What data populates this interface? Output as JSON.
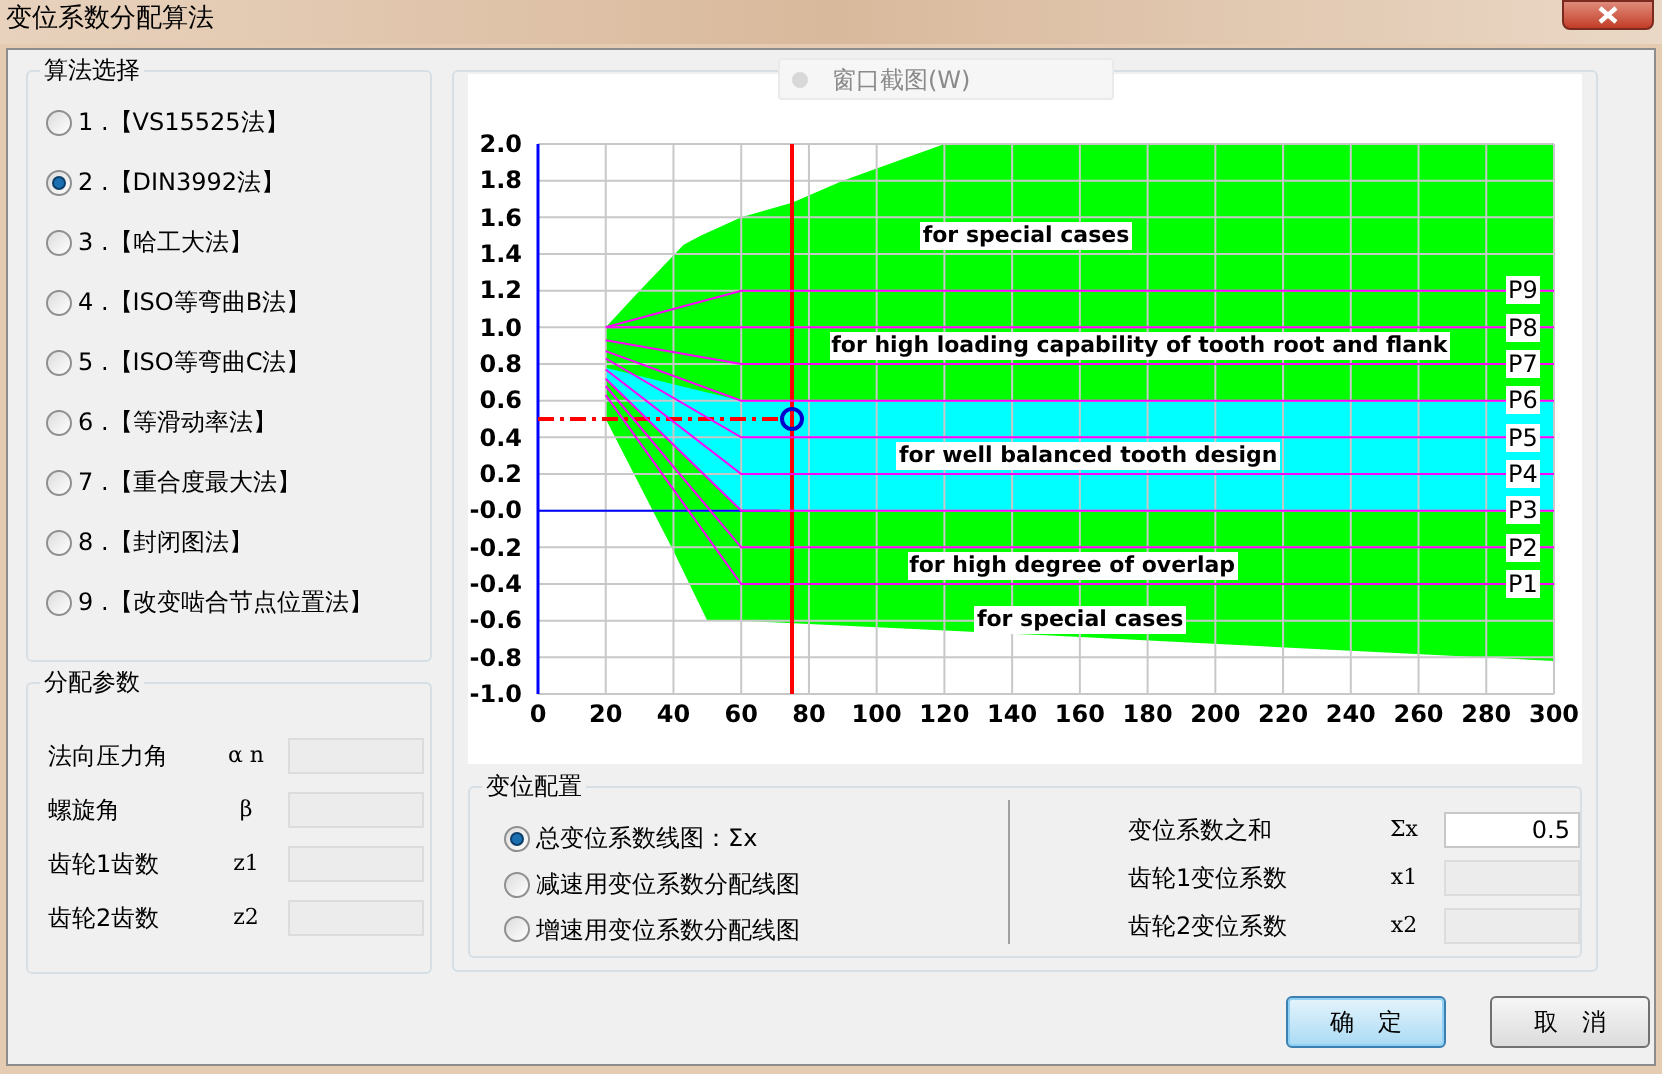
{
  "window": {
    "title": "变位系数分配算法"
  },
  "overlay": {
    "label": "窗口截图(W)"
  },
  "algorithm_group": {
    "title": "算法选择",
    "options": [
      {
        "label": "1 .【VS15525法】",
        "selected": false
      },
      {
        "label": "2 .【DIN3992法】",
        "selected": true
      },
      {
        "label": "3 .【哈工大法】",
        "selected": false
      },
      {
        "label": "4 .【ISO等弯曲B法】",
        "selected": false
      },
      {
        "label": "5 .【ISO等弯曲C法】",
        "selected": false
      },
      {
        "label": "6 .【等滑动率法】",
        "selected": false
      },
      {
        "label": "7 .【重合度最大法】",
        "selected": false
      },
      {
        "label": "8 .【封闭图法】",
        "selected": false
      },
      {
        "label": "9 .【改变啮合节点位置法】",
        "selected": false
      }
    ]
  },
  "params_group": {
    "title": "分配参数",
    "fields": [
      {
        "label": "法向压力角",
        "symbol": "α n",
        "disabled": true
      },
      {
        "label": "螺旋角",
        "symbol": "β",
        "disabled": true
      },
      {
        "label": "齿轮1齿数",
        "symbol": "z1",
        "disabled": true
      },
      {
        "label": "齿轮2齿数",
        "symbol": "z2",
        "disabled": true
      }
    ]
  },
  "chart": {
    "chart_data": {
      "type": "line",
      "xlim": [
        0,
        300
      ],
      "ylim": [
        -1,
        2
      ],
      "xticks": [
        0,
        20,
        40,
        60,
        80,
        100,
        120,
        140,
        160,
        180,
        200,
        220,
        240,
        260,
        280,
        300
      ],
      "yticks": [
        {
          "value": 2,
          "label": "2.0"
        },
        {
          "value": 1.8,
          "label": "1.8"
        },
        {
          "value": 1.6,
          "label": "1.6"
        },
        {
          "value": 1.4,
          "label": "1.4"
        },
        {
          "value": 1.2,
          "label": "1.2"
        },
        {
          "value": 1,
          "label": "1.0"
        },
        {
          "value": 0.8,
          "label": "0.8"
        },
        {
          "value": 0.6,
          "label": "0.6"
        },
        {
          "value": 0.4,
          "label": "0.4"
        },
        {
          "value": 0.2,
          "label": "0.2"
        },
        {
          "value": 0,
          "label": "-0.0"
        },
        {
          "value": -0.2,
          "label": "-0.2"
        },
        {
          "value": -0.4,
          "label": "-0.4"
        },
        {
          "value": -0.6,
          "label": "-0.6"
        },
        {
          "value": -0.8,
          "label": "-0.8"
        },
        {
          "value": -1,
          "label": "-1.0"
        }
      ],
      "grid": true,
      "ref_lines": [
        {
          "axis": "y",
          "value": 0,
          "color": "#0000ff"
        },
        {
          "axis": "x",
          "value": 75,
          "color": "#ff0000"
        },
        {
          "axis": "y",
          "value": 0.5,
          "color": "#ff0000"
        }
      ],
      "x": [
        20,
        60,
        300
      ],
      "series": [
        {
          "name": "P9",
          "color": "#ff00ff",
          "values": [
            1.0,
            1.2,
            1.2
          ]
        },
        {
          "name": "P8",
          "color": "#ff00ff",
          "values": [
            1.0,
            1.0,
            1.0
          ]
        },
        {
          "name": "P7",
          "color": "#ff00ff",
          "values": [
            0.93,
            0.8,
            0.8
          ]
        },
        {
          "name": "P6",
          "color": "#ff00ff",
          "values": [
            0.87,
            0.6,
            0.6
          ]
        },
        {
          "name": "P5",
          "color": "#ff00ff",
          "values": [
            0.83,
            0.4,
            0.4
          ]
        },
        {
          "name": "P4",
          "color": "#ff00ff",
          "values": [
            0.77,
            0.2,
            0.2
          ]
        },
        {
          "name": "P3",
          "color": "#ff00ff",
          "values": [
            0.72,
            0.0,
            0.0
          ]
        },
        {
          "name": "P2",
          "color": "#ff00ff",
          "values": [
            0.68,
            -0.2,
            -0.2
          ]
        },
        {
          "name": "P1",
          "color": "#ff00ff",
          "values": [
            0.63,
            -0.4,
            -0.4
          ]
        }
      ],
      "annotations": [
        "for special cases",
        "for high loading capability of tooth root and flank",
        "for well balanced tooth design",
        "for high degree of overlap",
        "for special cases"
      ]
    }
  },
  "shift_group": {
    "title": "变位配置",
    "options": [
      {
        "label": "总变位系数线图：Σx",
        "selected": true
      },
      {
        "label": "减速用变位系数分配线图",
        "selected": false
      },
      {
        "label": "增速用变位系数分配线图",
        "selected": false
      }
    ],
    "fields": [
      {
        "label": "变位系数之和",
        "symbol": "Σx",
        "value": "0.5",
        "disabled": false
      },
      {
        "label": "齿轮1变位系数",
        "symbol": "x1",
        "disabled": true
      },
      {
        "label": "齿轮2变位系数",
        "symbol": "x2",
        "disabled": true
      }
    ]
  },
  "buttons": [
    {
      "label": "确　定",
      "focused": true
    },
    {
      "label": "取　消",
      "focused": false
    }
  ]
}
